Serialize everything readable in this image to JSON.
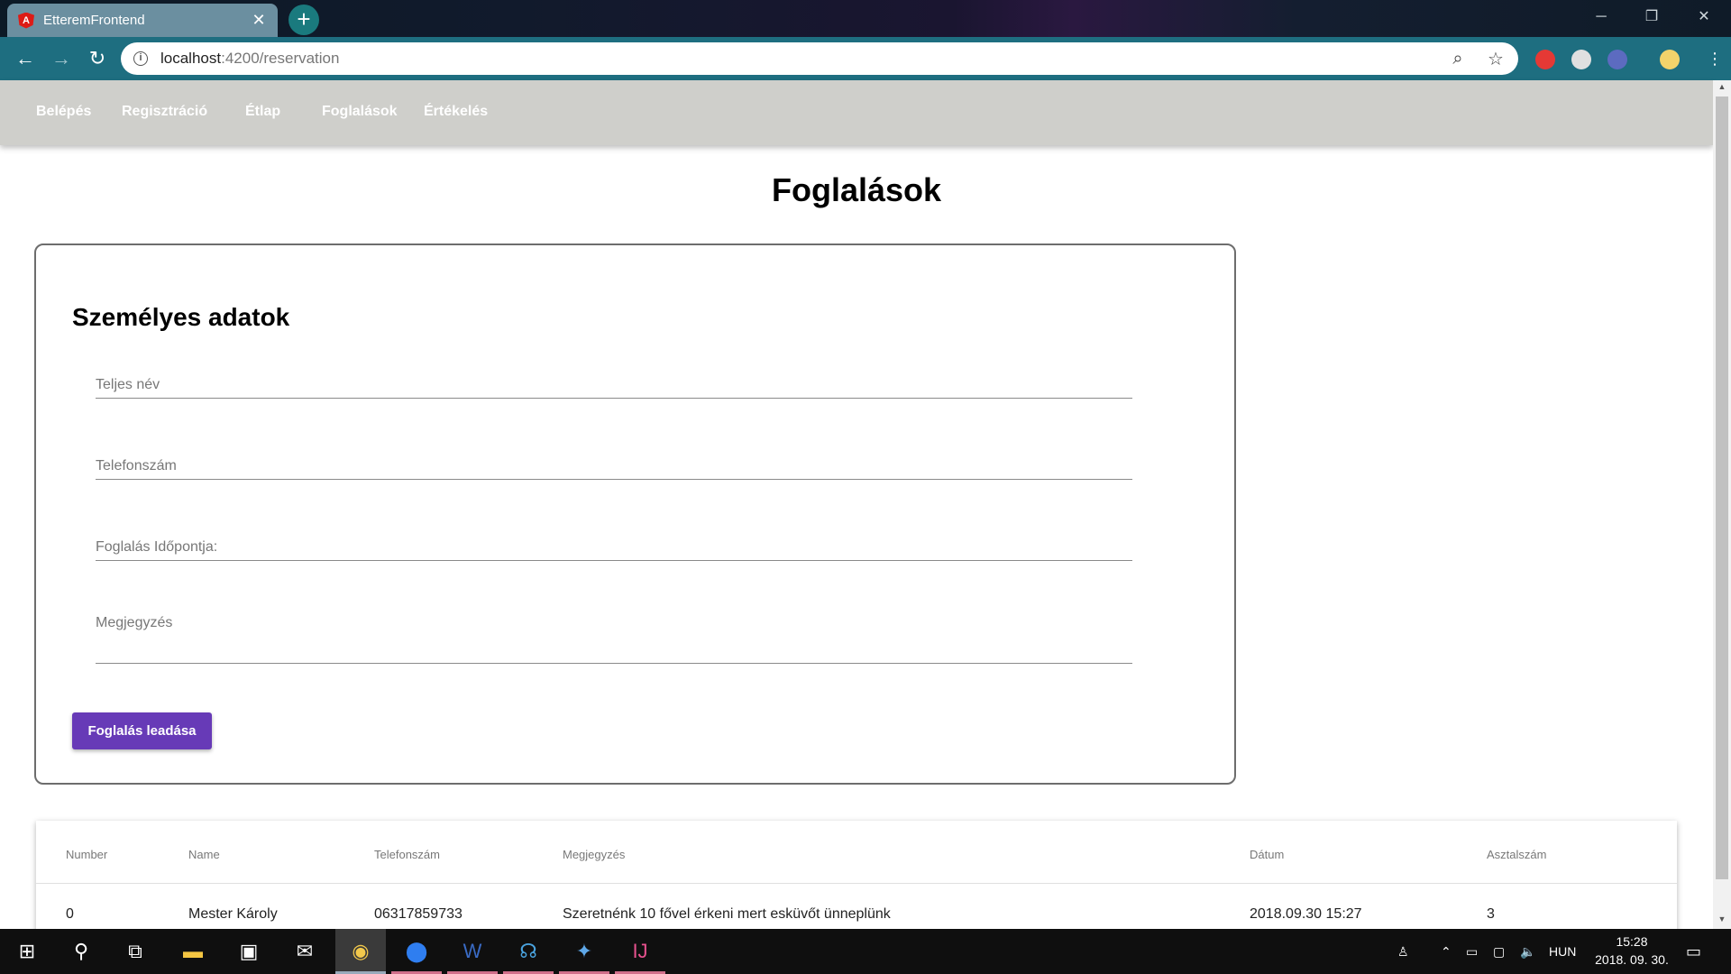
{
  "browser": {
    "tab_title": "EtteremFrontend",
    "url_host": "localhost",
    "url_path": ":4200/reservation"
  },
  "nav": {
    "items": [
      {
        "label": "Belépés"
      },
      {
        "label": "Regisztráció"
      },
      {
        "label": "Étlap"
      },
      {
        "label": "Foglalások"
      },
      {
        "label": "Értékelés"
      }
    ]
  },
  "page": {
    "title": "Foglalások"
  },
  "form": {
    "section_title": "Személyes adatok",
    "fields": {
      "full_name_placeholder": "Teljes név",
      "phone_placeholder": "Telefonszám",
      "datetime_placeholder": "Foglalás Időpontja:",
      "note_placeholder": "Megjegyzés"
    },
    "submit_label": "Foglalás leadása"
  },
  "table": {
    "headers": [
      "Number",
      "Name",
      "Telefonszám",
      "Megjegyzés",
      "Dátum",
      "Asztalszám"
    ],
    "rows": [
      [
        "0",
        "Mester Károly",
        "06317859733",
        "Szeretnénk 10 fővel érkeni mert esküvőt ünneplünk",
        "2018.09.30 15:27",
        "3"
      ]
    ]
  },
  "taskbar": {
    "language": "HUN",
    "time": "15:28",
    "date": "2018. 09. 30."
  },
  "icons": {
    "tab": "angular-favicon",
    "browser": [
      "back-icon",
      "forward-icon",
      "reload-icon",
      "info-icon",
      "zoom-icon",
      "star-icon"
    ]
  },
  "colors": {
    "toolbar": "#1e6e80",
    "nav": "#cfcfcb",
    "submit": "#673ab7"
  }
}
